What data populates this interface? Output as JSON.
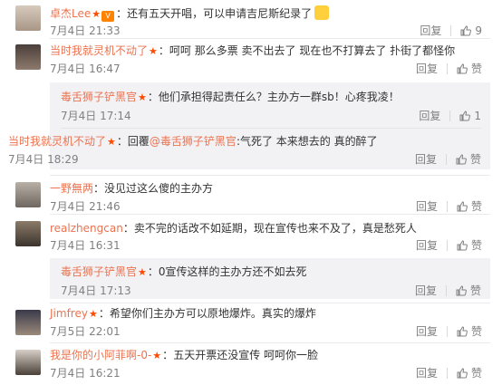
{
  "comments": [
    {
      "user": "卓杰Lee",
      "has_vip": true,
      "text": "还有五天开唱，可以申请吉尼斯纪录了",
      "time": "7月4日 21:33",
      "reply": "回复",
      "likes": "9"
    },
    {
      "user": "当时我就灵机不动了",
      "text": "呵呵 那么多票 卖不出去了 现在也不打算去了 扑街了都怪你",
      "time": "7月4日 16:47",
      "reply": "回复",
      "likes": "赞"
    },
    {
      "user": "毒舌狮子铲黑官",
      "text": "他们承担得起责任么？主办方一群sb！心疼我凌！",
      "time": "7月4日 17:14",
      "reply": "回复",
      "likes": "1"
    },
    {
      "user": "当时我就灵机不动了",
      "reply_prefix": "回覆",
      "mention": "@毒舌狮子铲黑官",
      "text": "气死了 本来想去的 真的醉了",
      "time": "7月4日 18:29",
      "reply": "回复",
      "likes": "赞"
    },
    {
      "user": "一野無两",
      "text": "没见过这么傻的主办方",
      "time": "7月4日 21:46",
      "reply": "回复",
      "likes": "赞"
    },
    {
      "user": "realzhengcan",
      "text": "卖不完的话改不如延期，现在宣传也来不及了，真是愁死人",
      "time": "7月4日 16:31",
      "reply": "回复",
      "likes": "赞"
    },
    {
      "user": "毒舌狮子铲黑官",
      "text": "0宣传这样的主办方还不如去死",
      "time": "7月4日 17:13",
      "reply": "回复",
      "likes": "赞"
    },
    {
      "user": "Jimfrey",
      "text": "希望你们主办方可以原地爆炸。真实的爆炸",
      "time": "7月5日 22:01",
      "reply": "回复",
      "likes": "赞"
    },
    {
      "user": "我是你的小阿菲啊-0-",
      "text": "五天开票还没宣传 呵呵你一脸",
      "time": "7月4日 16:21",
      "reply": "回复",
      "likes": "赞"
    }
  ],
  "colors": {
    "username": "#eb7350",
    "time": "#808080",
    "reply_bg": "#f2f2f5",
    "star": "#ff4a00"
  }
}
